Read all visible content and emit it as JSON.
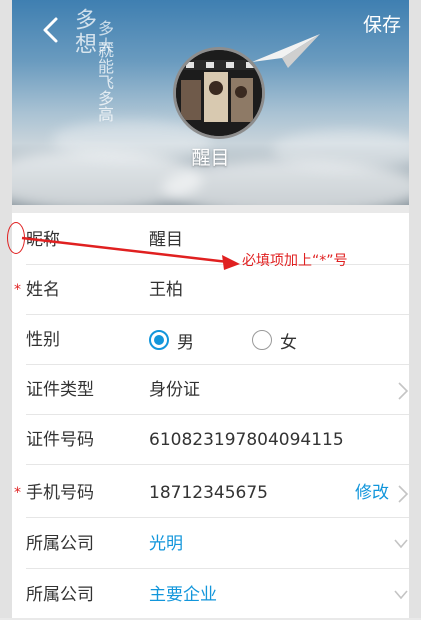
{
  "header": {
    "back_icon": "back-arrow-icon",
    "save_label": "保存",
    "nickname": "醒目",
    "poem_big": "想",
    "poem_top": "多",
    "poem_col2": "多大",
    "poem_col3": "就能飞多高"
  },
  "form": {
    "rows": [
      {
        "label": "昵称",
        "value": "醒目"
      },
      {
        "label": "姓名",
        "value": "王柏",
        "required_mark": "*"
      },
      {
        "label": "性别",
        "options": [
          "男",
          "女"
        ],
        "selected": "男"
      },
      {
        "label": "证件类型",
        "value": "身份证"
      },
      {
        "label": "证件号码",
        "value": "610823197804094115"
      },
      {
        "label": "手机号码",
        "value": "18712345675",
        "required_mark": "*",
        "action": "修改"
      },
      {
        "label": "所属公司",
        "value": "光明"
      },
      {
        "label": "所属公司",
        "value": "主要企业"
      }
    ]
  },
  "annotation": {
    "text": "必填项加上“*”号"
  },
  "colors": {
    "accent": "#1296db",
    "annotation": "#e02020"
  }
}
